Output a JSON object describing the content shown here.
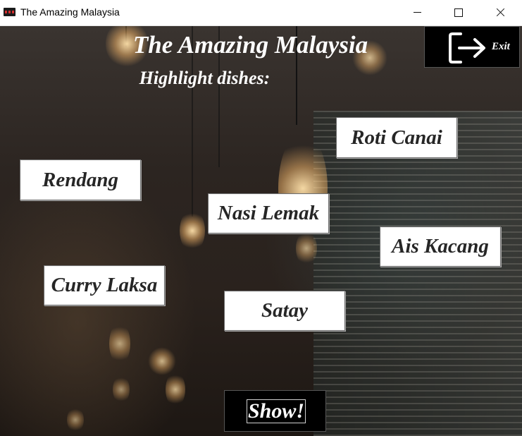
{
  "window": {
    "title": "The Amazing Malaysia",
    "controls": [
      "minimize-icon",
      "maximize-icon",
      "close-icon"
    ]
  },
  "header": {
    "title": "The Amazing Malaysia",
    "subtitle": "Highlight dishes:"
  },
  "exit_button": {
    "label": "Exit",
    "icon": "exit-icon"
  },
  "dishes": [
    "Roti Canai",
    "Rendang",
    "Nasi Lemak",
    "Ais Kacang",
    "Curry Laksa",
    "Satay"
  ],
  "show_button": {
    "label": "Show!"
  },
  "colors": {
    "button_bg": "#ffffff",
    "button_text": "#262626",
    "dark_button_bg": "#000000",
    "heading_text": "#ffffff"
  }
}
